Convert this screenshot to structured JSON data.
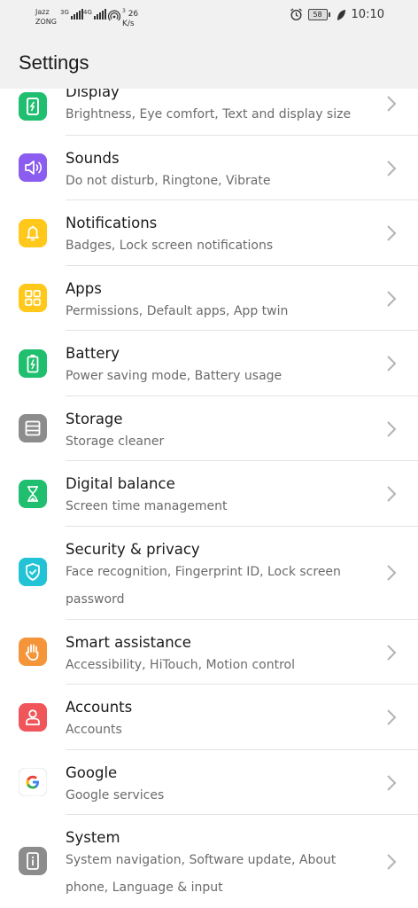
{
  "status_bar": {
    "carrier1": "Jazz",
    "carrier2": "ZONG",
    "net1": "3G",
    "net2": "4G",
    "speed_value": "26",
    "speed_unit": "K/s",
    "hotspot_count": "3",
    "battery": "58",
    "time": "10:10"
  },
  "header": {
    "title": "Settings"
  },
  "items": [
    {
      "title": "Display",
      "subtitle": "Brightness, Eye comfort, Text and display size",
      "icon": "display-icon",
      "color": "#1fbf6f"
    },
    {
      "title": "Sounds",
      "subtitle": "Do not disturb, Ringtone, Vibrate",
      "icon": "sound-icon",
      "color": "#8a5cf0"
    },
    {
      "title": "Notifications",
      "subtitle": "Badges, Lock screen notifications",
      "icon": "bell-icon",
      "color": "#ffc81a"
    },
    {
      "title": "Apps",
      "subtitle": "Permissions, Default apps, App twin",
      "icon": "apps-grid-icon",
      "color": "#ffc81a"
    },
    {
      "title": "Battery",
      "subtitle": "Power saving mode, Battery usage",
      "icon": "battery-icon",
      "color": "#1fbf6f"
    },
    {
      "title": "Storage",
      "subtitle": "Storage cleaner",
      "icon": "storage-icon",
      "color": "#8c8c8c"
    },
    {
      "title": "Digital balance",
      "subtitle": "Screen time management",
      "icon": "hourglass-icon",
      "color": "#1fbf6f"
    },
    {
      "title": "Security & privacy",
      "subtitle": "Face recognition, Fingerprint ID, Lock screen password",
      "icon": "shield-icon",
      "color": "#22c3d6"
    },
    {
      "title": "Smart assistance",
      "subtitle": "Accessibility, HiTouch, Motion control",
      "icon": "hand-icon",
      "color": "#f5953a"
    },
    {
      "title": "Accounts",
      "subtitle": "Accounts",
      "icon": "account-icon",
      "color": "#f0555a"
    },
    {
      "title": "Google",
      "subtitle": "Google services",
      "icon": "google-icon",
      "color": "#ffffff"
    },
    {
      "title": "System",
      "subtitle": "System navigation, Software update, About phone, Language & input",
      "icon": "system-info-icon",
      "color": "#8c8c8c"
    }
  ]
}
